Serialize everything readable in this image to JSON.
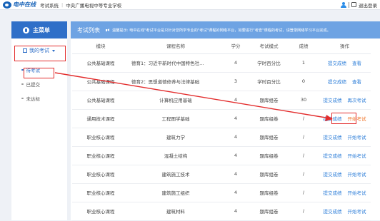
{
  "header": {
    "logo_text": "电中在线",
    "system_name": "考试系统",
    "separator": "|",
    "school_name": "中央广播电视中等专业学校",
    "user_label": "",
    "logout_label": "退出登录"
  },
  "sidebar": {
    "title": "主菜单",
    "group_label": "我的考试",
    "items": [
      {
        "label": "待考试",
        "active": true
      },
      {
        "label": "已提交",
        "active": false
      },
      {
        "label": "未达标",
        "active": false
      }
    ]
  },
  "main": {
    "title": "考试列表",
    "notice": "温馨提示: 电中在线\"考试平台是只针对您所学专业的\"考试\"课程的网络平台，如要进行\"考查\"课程的考试，请登录网络学习平台完成。",
    "columns": [
      "模块",
      "课程名称",
      "学分",
      "考试模式",
      "成绩",
      "操作"
    ],
    "rows": [
      {
        "module": "公共基础课程",
        "course": "德育1：习近平新时代中国特色社...",
        "credit": "4",
        "mode": "学时百分比",
        "score": "1",
        "op1": "提交成绩",
        "op2": "查看"
      },
      {
        "module": "公共基础课程",
        "course": "德育2：思想道德修养与法律基础",
        "credit": "3",
        "mode": "学时百分比",
        "score": "0",
        "op1": "提交成绩",
        "op2": "查看"
      },
      {
        "module": "公共基础课程",
        "course": "计算机应用基础",
        "credit": "4",
        "mode": "题库组卷",
        "score": "30",
        "op1": "提交成绩",
        "op2": "再次考试"
      },
      {
        "module": "通用技术课程",
        "course": "工程图学基础",
        "credit": "4",
        "mode": "题库组卷",
        "score": "/",
        "op1": "提交成绩",
        "op2": "开始考试"
      },
      {
        "module": "职业核心课程",
        "course": "建筑力学",
        "credit": "4",
        "mode": "题库组卷",
        "score": "/",
        "op1": "提交成绩",
        "op2": "开始考试"
      },
      {
        "module": "职业核心课程",
        "course": "混凝土结构",
        "credit": "4",
        "mode": "题库组卷",
        "score": "/",
        "op1": "提交成绩",
        "op2": "开始考试"
      },
      {
        "module": "职业核心课程",
        "course": "建筑施工技术",
        "credit": "4",
        "mode": "题库组卷",
        "score": "/",
        "op1": "提交成绩",
        "op2": "开始考试"
      },
      {
        "module": "职业核心课程",
        "course": "建筑施工组织",
        "credit": "4",
        "mode": "题库组卷",
        "score": "/",
        "op1": "提交成绩",
        "op2": "开始考试"
      },
      {
        "module": "职业核心课程",
        "course": "建筑材料",
        "credit": "4",
        "mode": "题库组卷",
        "score": "/",
        "op1": "提交成绩",
        "op2": "开始考试"
      }
    ]
  },
  "colors": {
    "accent": "#2f6fc8",
    "header_light": "#6ea3e3",
    "link": "#2f7fd9",
    "link_orange": "#f0762a",
    "annotation_red": "#e32d2d"
  }
}
